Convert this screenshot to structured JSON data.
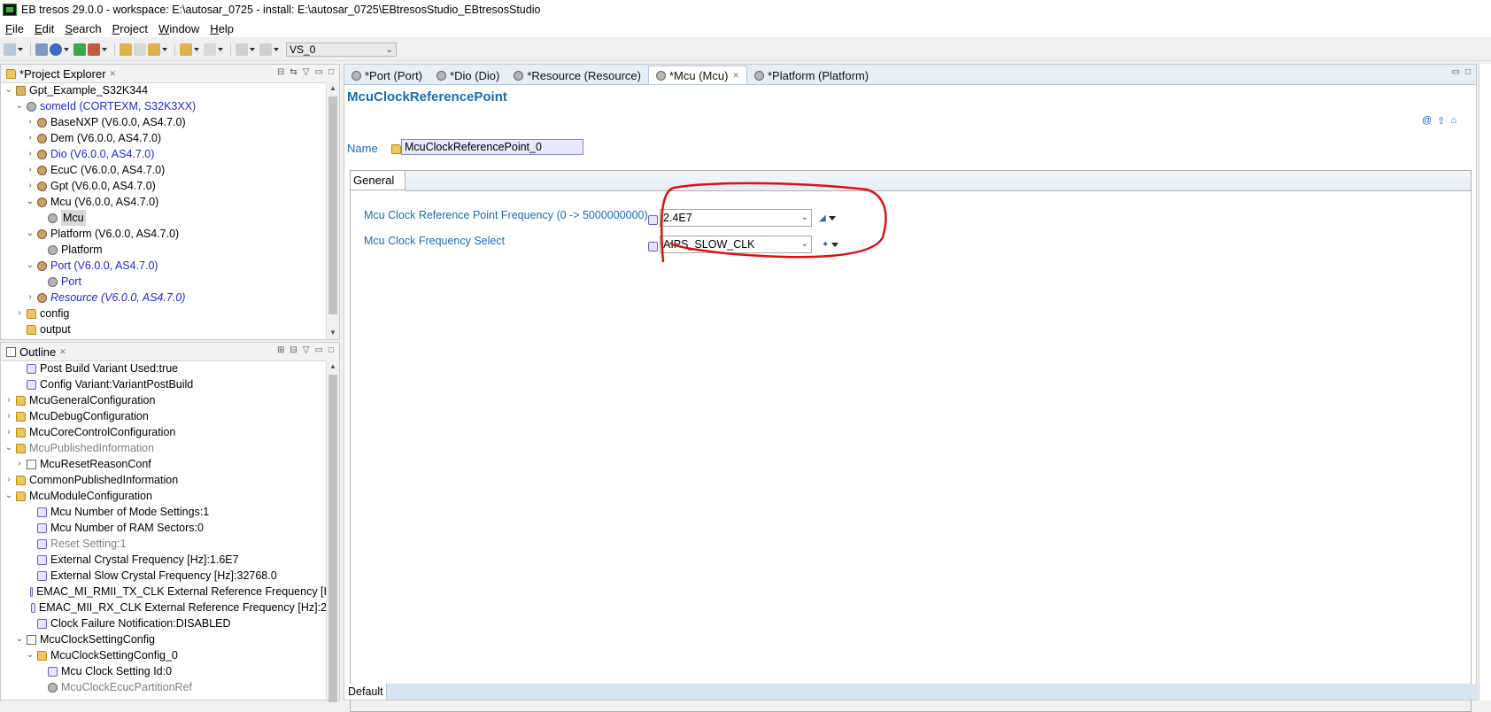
{
  "window": {
    "title": "EB tresos 29.0.0 - workspace: E:\\autosar_0725 - install: E:\\autosar_0725\\EBtresosStudio_EBtresosStudio"
  },
  "menu": [
    {
      "pre": "",
      "ul": "F",
      "post": "ile"
    },
    {
      "pre": "",
      "ul": "E",
      "post": "dit"
    },
    {
      "pre": "",
      "ul": "S",
      "post": "earch"
    },
    {
      "pre": "",
      "ul": "P",
      "post": "roject"
    },
    {
      "pre": "",
      "ul": "W",
      "post": "indow"
    },
    {
      "pre": "",
      "ul": "H",
      "post": "elp"
    }
  ],
  "toolbar": {
    "variant_value": "VS_0"
  },
  "project_explorer": {
    "tab_label": "*Project Explorer",
    "rows": [
      {
        "indent": 0,
        "chev": "v",
        "icon": "proj",
        "label": "Gpt_Example_S32K344",
        "style": ""
      },
      {
        "indent": 1,
        "chev": "v",
        "icon": "gear",
        "label": "someId (CORTEXM, S32K3XX)",
        "style": "blue"
      },
      {
        "indent": 2,
        "chev": ">",
        "icon": "mod",
        "label": "BaseNXP (V6.0.0, AS4.7.0)",
        "style": ""
      },
      {
        "indent": 2,
        "chev": ">",
        "icon": "mod",
        "label": "Dem (V6.0.0, AS4.7.0)",
        "style": ""
      },
      {
        "indent": 2,
        "chev": ">",
        "icon": "mod",
        "label": "Dio (V6.0.0, AS4.7.0)",
        "style": "blue"
      },
      {
        "indent": 2,
        "chev": ">",
        "icon": "mod",
        "label": "EcuC (V6.0.0, AS4.7.0)",
        "style": ""
      },
      {
        "indent": 2,
        "chev": ">",
        "icon": "mod",
        "label": "Gpt (V6.0.0, AS4.7.0)",
        "style": ""
      },
      {
        "indent": 2,
        "chev": "v",
        "icon": "mod",
        "label": "Mcu (V6.0.0, AS4.7.0)",
        "style": ""
      },
      {
        "indent": 3,
        "chev": "",
        "icon": "gear",
        "label": "Mcu",
        "style": "selected"
      },
      {
        "indent": 2,
        "chev": "v",
        "icon": "mod",
        "label": "Platform (V6.0.0, AS4.7.0)",
        "style": ""
      },
      {
        "indent": 3,
        "chev": "",
        "icon": "gear",
        "label": "Platform",
        "style": ""
      },
      {
        "indent": 2,
        "chev": "v",
        "icon": "mod",
        "label": "Port (V6.0.0, AS4.7.0)",
        "style": "blue"
      },
      {
        "indent": 3,
        "chev": "",
        "icon": "gear",
        "label": "Port",
        "style": "blue"
      },
      {
        "indent": 2,
        "chev": ">",
        "icon": "mod",
        "label": "Resource (V6.0.0, AS4.7.0)",
        "style": "blue italic"
      },
      {
        "indent": 1,
        "chev": ">",
        "icon": "folder",
        "label": "config",
        "style": ""
      },
      {
        "indent": 1,
        "chev": "",
        "icon": "folder",
        "label": "output",
        "style": ""
      }
    ]
  },
  "outline": {
    "tab_label": "Outline",
    "rows": [
      {
        "indent": 1,
        "chev": "",
        "icon": "param",
        "label": "Post Build Variant Used:true",
        "style": ""
      },
      {
        "indent": 1,
        "chev": "",
        "icon": "param",
        "label": "Config Variant:VariantPostBuild",
        "style": ""
      },
      {
        "indent": 0,
        "chev": ">",
        "icon": "folder",
        "label": "McuGeneralConfiguration",
        "style": ""
      },
      {
        "indent": 0,
        "chev": ">",
        "icon": "folder",
        "label": "McuDebugConfiguration",
        "style": ""
      },
      {
        "indent": 0,
        "chev": ">",
        "icon": "folder",
        "label": "McuCoreControlConfiguration",
        "style": ""
      },
      {
        "indent": 0,
        "chev": "v",
        "icon": "folder",
        "label": "McuPublishedInformation",
        "style": "gray"
      },
      {
        "indent": 1,
        "chev": ">",
        "icon": "table",
        "label": "McuResetReasonConf",
        "style": ""
      },
      {
        "indent": 0,
        "chev": ">",
        "icon": "folder",
        "label": "CommonPublishedInformation",
        "style": ""
      },
      {
        "indent": 0,
        "chev": "v",
        "icon": "folder",
        "label": "McuModuleConfiguration",
        "style": ""
      },
      {
        "indent": 2,
        "chev": "",
        "icon": "param",
        "label": "Mcu Number of Mode Settings:1",
        "style": ""
      },
      {
        "indent": 2,
        "chev": "",
        "icon": "param",
        "label": "Mcu Number of RAM Sectors:0",
        "style": ""
      },
      {
        "indent": 2,
        "chev": "",
        "icon": "param",
        "label": "Reset Setting:1",
        "style": "gray"
      },
      {
        "indent": 2,
        "chev": "",
        "icon": "param",
        "label": "External Crystal Frequency [Hz]:1.6E7",
        "style": ""
      },
      {
        "indent": 2,
        "chev": "",
        "icon": "param",
        "label": "External Slow Crystal Frequency [Hz]:32768.0",
        "style": ""
      },
      {
        "indent": 2,
        "chev": "",
        "icon": "param",
        "label": "EMAC_MI_RMII_TX_CLK External Reference Frequency [I",
        "style": ""
      },
      {
        "indent": 2,
        "chev": "",
        "icon": "param",
        "label": "EMAC_MII_RX_CLK External Reference Frequency [Hz]:2",
        "style": ""
      },
      {
        "indent": 2,
        "chev": "",
        "icon": "param",
        "label": "Clock Failure Notification:DISABLED",
        "style": ""
      },
      {
        "indent": 1,
        "chev": "v",
        "icon": "table",
        "label": "McuClockSettingConfig",
        "style": ""
      },
      {
        "indent": 2,
        "chev": "v",
        "icon": "folder",
        "label": "McuClockSettingConfig_0",
        "style": ""
      },
      {
        "indent": 3,
        "chev": "",
        "icon": "param",
        "label": "Mcu Clock Setting Id:0",
        "style": ""
      },
      {
        "indent": 3,
        "chev": "",
        "icon": "gear",
        "label": "McuClockEcucPartitionRef",
        "style": "gray"
      }
    ]
  },
  "editor": {
    "tabs": [
      {
        "label": "*Port (Port)",
        "active": false
      },
      {
        "label": "*Dio (Dio)",
        "active": false
      },
      {
        "label": "*Resource (Resource)",
        "active": false
      },
      {
        "label": "*Mcu (Mcu)",
        "active": true
      },
      {
        "label": "*Platform (Platform)",
        "active": false
      }
    ],
    "form_title": "McuClockReferencePoint",
    "name_label": "Name",
    "name_value": "McuClockReferencePoint_0",
    "group_tab": "General",
    "params": [
      {
        "label": "Mcu Clock Reference Point Frequency (0 -> 5000000000)",
        "value": "2.4E7"
      },
      {
        "label": "Mcu Clock Frequency Select",
        "value": "AIPS_SLOW_CLK"
      }
    ],
    "bottom_tab": "Default"
  },
  "annotation": {
    "color": "#e01010"
  }
}
